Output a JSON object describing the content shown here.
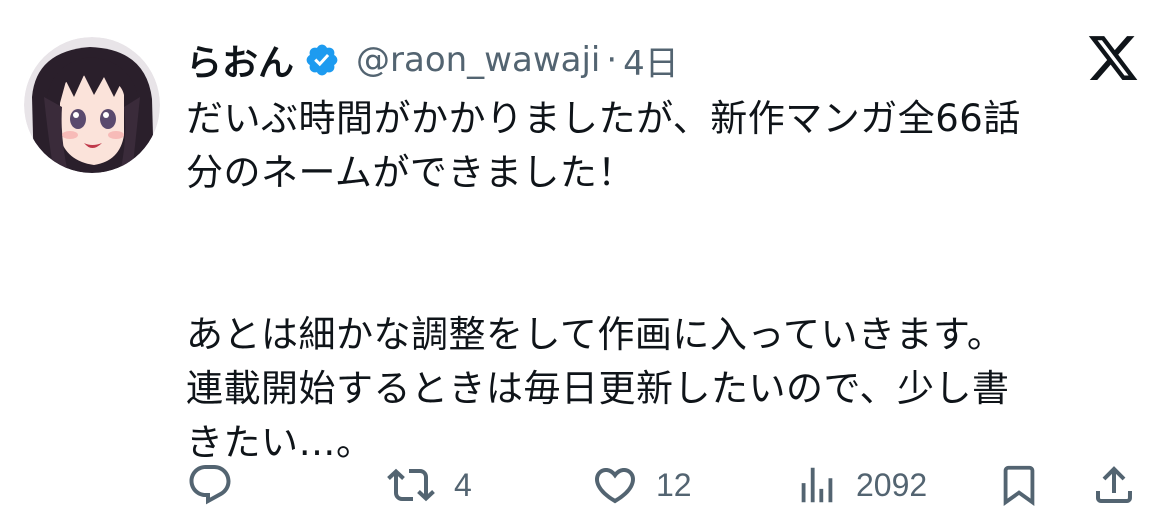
{
  "tweet": {
    "display_name": "らおん",
    "handle": "@raon_wawaji",
    "separator": "·",
    "time": "4日",
    "body_lines": [
      "だいぶ時間がかかりましたが、新作マンガ全66話",
      "分のネームができました！",
      "あとは細かな調整をして作画に入っていきます。",
      "連載開始するときは毎日更新したいので、少し書",
      "きたい…。"
    ],
    "verified_color": "#1d9bf0",
    "text_color": "#0f1419",
    "secondary_color": "#536471"
  },
  "actions": {
    "reply_icon": "reply-icon",
    "retweet_icon": "retweet-icon",
    "retweet_count": "4",
    "like_icon": "heart-icon",
    "like_count": "12",
    "views_icon": "views-icon",
    "views_count": "2092",
    "bookmark_icon": "bookmark-icon",
    "share_icon": "share-icon"
  },
  "brand": {
    "logo_icon": "x-logo-icon"
  }
}
